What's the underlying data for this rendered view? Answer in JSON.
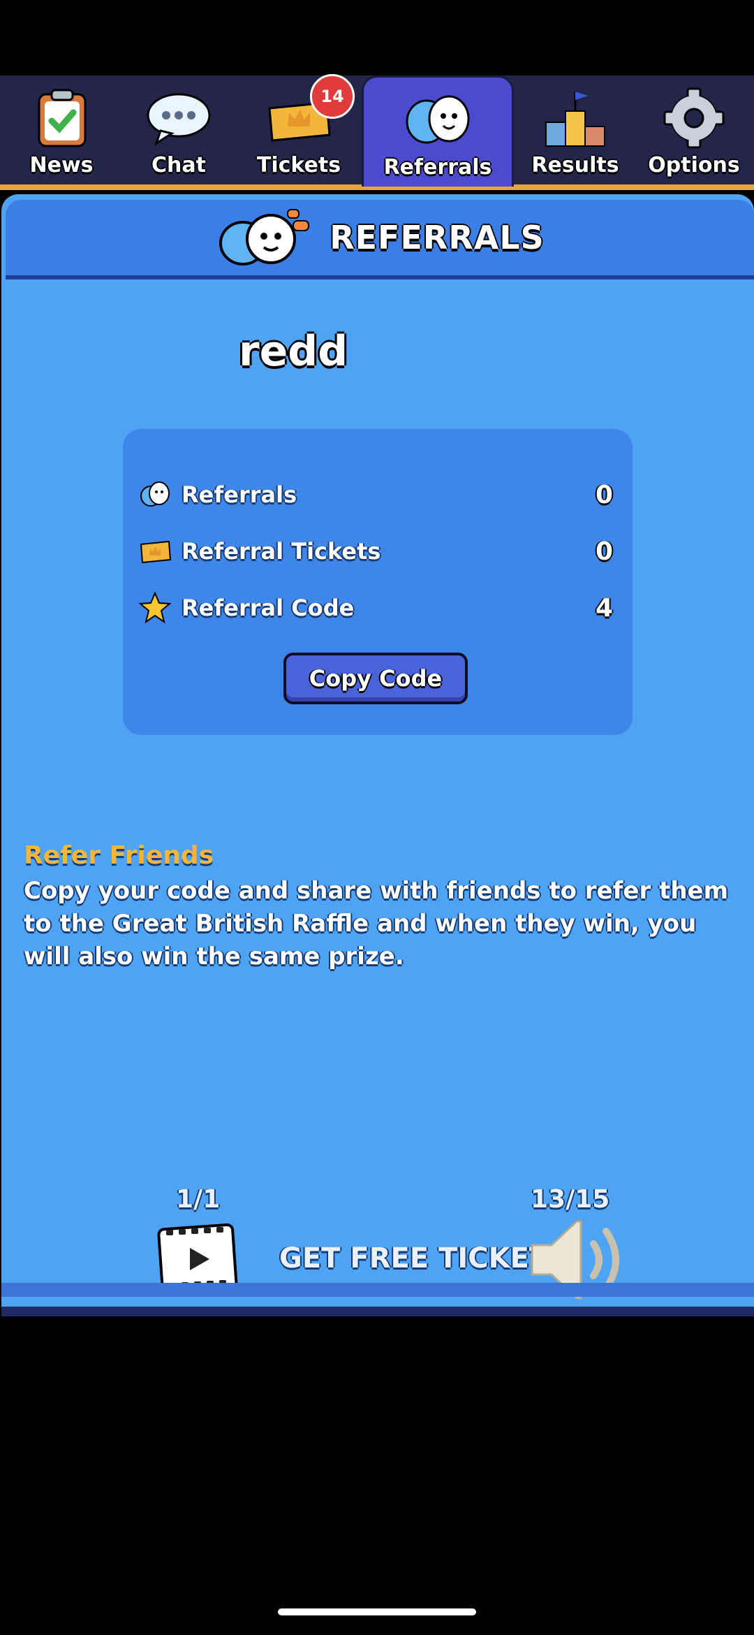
{
  "nav": {
    "tabs": [
      {
        "label": "News",
        "icon": "clipboard-check-icon"
      },
      {
        "label": "Chat",
        "icon": "speech-bubble-icon"
      },
      {
        "label": "Tickets",
        "icon": "ticket-icon",
        "badge": "14"
      },
      {
        "label": "Referrals",
        "icon": "friends-icon",
        "active": true
      },
      {
        "label": "Results",
        "icon": "podium-icon"
      },
      {
        "label": "Options",
        "icon": "gear-icon"
      }
    ]
  },
  "header": {
    "title": "REFERRALS"
  },
  "profile": {
    "username": "redd"
  },
  "stats": [
    {
      "label": "Referrals",
      "value": "0",
      "icon": "friends-icon"
    },
    {
      "label": "Referral Tickets",
      "value": "0",
      "icon": "ticket-icon"
    },
    {
      "label": "Referral Code",
      "value": "4",
      "icon": "star-icon"
    }
  ],
  "copy_button": {
    "label": "Copy Code"
  },
  "refer": {
    "title": "Refer Friends",
    "body": "Copy your code and share with friends to refer them to the Great British Raffle and when they win, you will also win the same prize."
  },
  "footer": {
    "video_count": "1/1",
    "free_label": "GET FREE TICKETS",
    "sound_count": "13/15"
  },
  "colors": {
    "panel": "#4ea3f2",
    "header": "#3b7ee6",
    "nav_bg": "#23264a",
    "active_tab": "#4c4bd0",
    "accent_orange": "#f4b53a",
    "badge_red": "#e23b3b"
  }
}
